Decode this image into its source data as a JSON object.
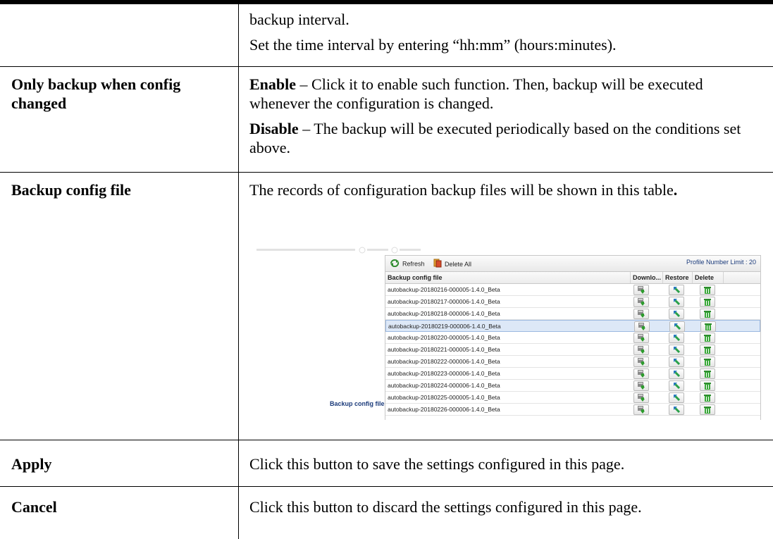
{
  "rows": [
    {
      "term": "",
      "paragraphs": [
        {
          "bold": "",
          "text": "backup interval."
        },
        {
          "bold": "",
          "text": "Set the time interval by entering “hh:mm” (hours:minutes)."
        }
      ]
    },
    {
      "term": "Only backup when config changed",
      "paragraphs": [
        {
          "bold": "Enable",
          "text": " – Click it to enable such function. Then, backup will be executed whenever the configuration is changed."
        },
        {
          "bold": "Disable",
          "text": " – The backup will be executed periodically based on the conditions set above."
        }
      ]
    },
    {
      "term": "Backup config file",
      "paragraphs": [
        {
          "bold": "",
          "text": "The records of configuration backup files will be shown in this table"
        }
      ]
    },
    {
      "term": "Apply",
      "paragraphs": [
        {
          "bold": "",
          "text": "Click this button to save the settings configured in this page."
        }
      ]
    },
    {
      "term": "Cancel",
      "paragraphs": [
        {
          "bold": "",
          "text": "Click this button to discard the settings configured in this page."
        }
      ]
    }
  ],
  "screenshot": {
    "side_label": "Backup config file :",
    "toolbar": {
      "refresh_label": "Refresh",
      "delete_all_label": "Delete All",
      "limit_label": "Profile Number Limit : 20"
    },
    "columns": [
      "Backup config file",
      "Downlo...",
      "Restore",
      "Delete"
    ],
    "files": [
      "autobackup-20180216-000005-1.4.0_Beta",
      "autobackup-20180217-000006-1.4.0_Beta",
      "autobackup-20180218-000006-1.4.0_Beta",
      "autobackup-20180219-000006-1.4.0_Beta",
      "autobackup-20180220-000005-1.4.0_Beta",
      "autobackup-20180221-000005-1.4.0_Beta",
      "autobackup-20180222-000006-1.4.0_Beta",
      "autobackup-20180223-000006-1.4.0_Beta",
      "autobackup-20180224-000006-1.4.0_Beta",
      "autobackup-20180225-000005-1.4.0_Beta",
      "autobackup-20180226-000006-1.4.0_Beta"
    ],
    "selected_index": 3,
    "icons": {
      "download": "download-icon",
      "restore": "restore-icon",
      "delete": "trash-icon"
    }
  }
}
